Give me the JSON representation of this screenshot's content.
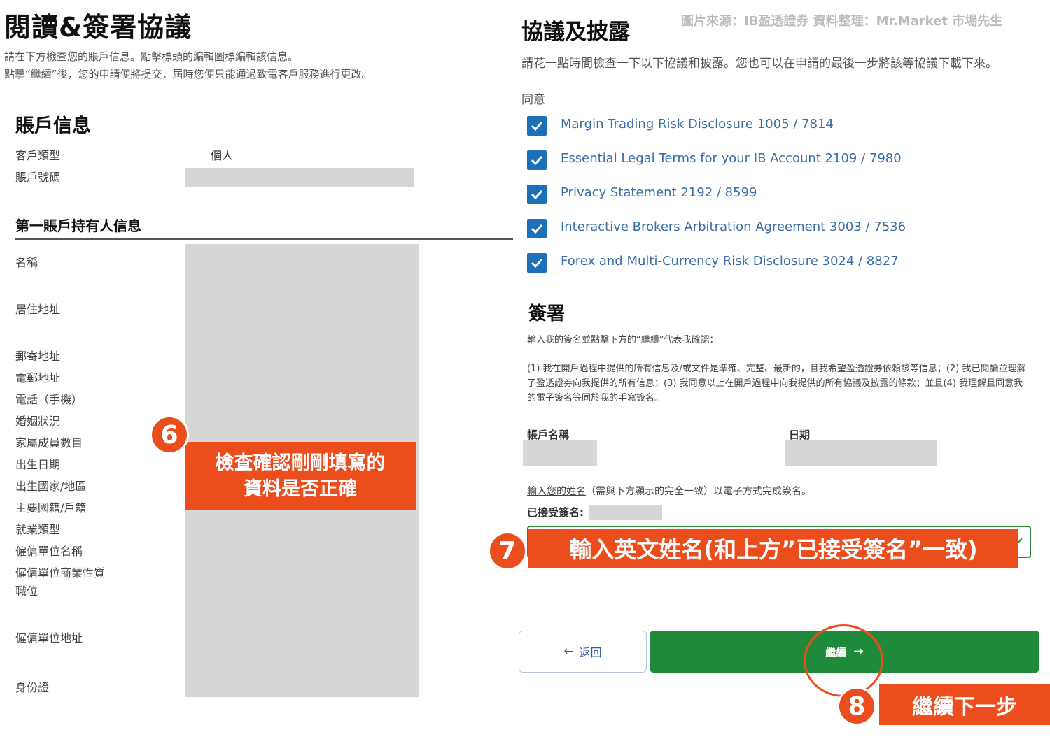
{
  "left": {
    "title": "閱讀&簽署協議",
    "intro_line1": "請在下方檢查您的賬戶信息。點擊標頭的編輯圖標編輯該信息。",
    "intro_line2": "點擊“繼續”後，您的申請便將提交，屆時您便只能通過致電客戶服務進行更改。",
    "account_info": {
      "heading": "賬戶信息",
      "client_type_label": "客戶類型",
      "client_type_value": "個人",
      "account_number_label": "賬戶號碼"
    },
    "holder_info": {
      "heading": "第一賬戶持有人信息",
      "fields": [
        "名稱",
        "居住地址",
        "郵寄地址",
        "電郵地址",
        "電話（手機）",
        "婚姻狀況",
        "家屬成員數目",
        "出生日期",
        "出生國家/地區",
        "主要國籍/戶籍",
        "就業類型",
        "僱傭單位名稱",
        "僱傭單位商業性質",
        "職位",
        "僱傭單位地址",
        "身份證"
      ]
    },
    "annotation6": {
      "number": "6",
      "line1": "檢查確認剛剛填寫的",
      "line2": "資料是否正確"
    }
  },
  "right": {
    "title": "協議及披露",
    "source": "圖片來源：IB盈透證券   資料整理：Mr.Market 市場先生",
    "desc": "請花一點時間檢查一下以下協議和披露。您也可以在申請的最後一步將該等協議下載下來。",
    "agree_label": "同意",
    "agreements": [
      "Margin Trading Risk Disclosure 1005 / 7814",
      "Essential Legal Terms for your IB Account 2109 / 7980",
      "Privacy Statement 2192 / 8599",
      "Interactive Brokers Arbitration Agreement 3003 / 7536",
      "Forex and Multi-Currency Risk Disclosure 3024 / 8827"
    ],
    "sign_heading": "簽署",
    "sign_intro": "輸入我的簽名並點擊下方的“繼續”代表我確認：",
    "legal_text": "(1) 我在開戶過程中提供的所有信息及/或文件是準確、完整、最新的，且我希望盈透證券依賴該等信息；(2) 我已閱讀並理解了盈透證券向我提供的所有信息；(3) 我同意以上在開戶過程中向我提供的所有協議及披露的條款；並且(4) 我理解且同意我的電子簽名等同於我的手寫簽名。",
    "account_name_label": "帳戶名稱",
    "date_label": "日期",
    "input_name_link": "輸入您的姓名",
    "input_name_rest": "（需與下方顯示的完全一致）以電子方式完成簽名。",
    "accepted_sig_label": "已接受簽名:",
    "annotation7": {
      "number": "7",
      "text": "輸入英文姓名(和上方”已接受簽名”一致)"
    },
    "back_label": "返回",
    "continue_label": "繼續",
    "annotation8": {
      "number": "8",
      "text": "繼續下一步"
    }
  },
  "colors": {
    "accent_orange": "#eb4e1c",
    "continue_green": "#1e8a3a",
    "checkbox_blue": "#1d70b8",
    "link_blue": "#3a6da8"
  }
}
